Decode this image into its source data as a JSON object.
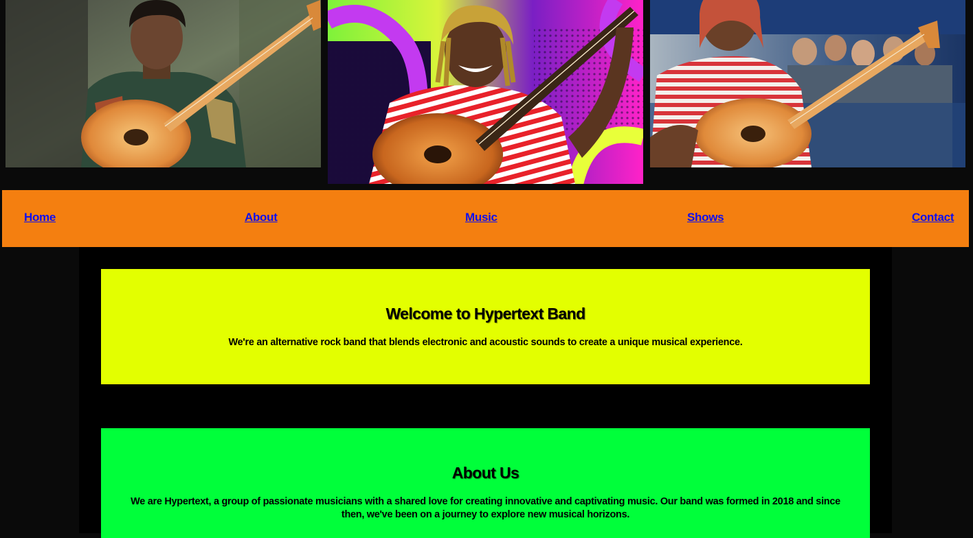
{
  "nav": {
    "home": "Home",
    "about": "About",
    "music": "Music",
    "shows": "Shows",
    "contact": "Contact"
  },
  "welcome": {
    "title": "Welcome to Hypertext Band",
    "text": "We're an alternative rock band that blends electronic and acoustic sounds to create a unique musical experience."
  },
  "about": {
    "title": "About Us",
    "text": "We are Hypertext, a group of passionate musicians with a shared love for creating innovative and captivating music. Our band was formed in 2018 and since then, we've been on a journey to explore new musical horizons."
  },
  "colors": {
    "page_bg": "#0a0a0a",
    "nav_bg": "#f47f10",
    "nav_link": "#1010ee",
    "welcome_bg": "#e3ff00",
    "about_bg": "#00ff3a",
    "content_bg": "#000000"
  },
  "images": {
    "photo1": "bassist-portrait-photo",
    "photo2": "bassist-illustration",
    "photo3": "bassist-live-photo"
  }
}
